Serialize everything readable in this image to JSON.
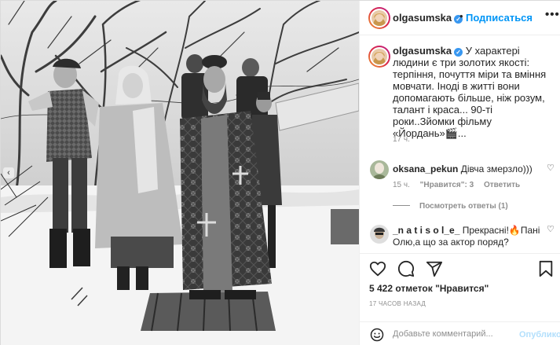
{
  "post": {
    "username": "olgasumska",
    "verified_mark": "✓",
    "dot": "•",
    "follow_label": "Подписаться",
    "more_label": "•••"
  },
  "caption": {
    "username": "olgasumska",
    "text": "У характері людини є три золотих якості: терпіння, почуття міри та вміння мовчати. Іноді в житті вони допомагають більше, ніж розум, талант і краса... 90-ті роки..Зйомки фільму «Йордань»🎬...",
    "time": "17 ч."
  },
  "comments": [
    {
      "username": "oksana_pekun",
      "text": "Дівча змерзло)))",
      "time": "15 ч.",
      "likes": "\"Нравится\": 3",
      "reply": "Ответить",
      "view_replies": "Посмотреть ответы (1)"
    },
    {
      "username": "_n a t i s o l_e_",
      "text": "Прекрасні!🔥Пані Олю,а що за актор поряд?"
    }
  ],
  "engagement": {
    "likes_count": "5 422",
    "likes_word": "отметок",
    "likes_suffix": "\"Нравится\"",
    "posted": "17 ЧАСОВ НАЗАД"
  },
  "comment_box": {
    "placeholder": "Добавьте комментарий...",
    "publish_label": "Опубликовать"
  },
  "icons": {
    "nav_left": "chevron-left-icon",
    "like": "heart-icon",
    "comment": "comment-icon",
    "share": "send-icon",
    "save": "bookmark-icon",
    "emoji": "smiley-icon"
  },
  "colors": {
    "accent": "#0095f6",
    "text": "#262626",
    "muted": "#8e8e8e",
    "publish_disabled": "#b2dffc",
    "verified": "#3897f0"
  }
}
